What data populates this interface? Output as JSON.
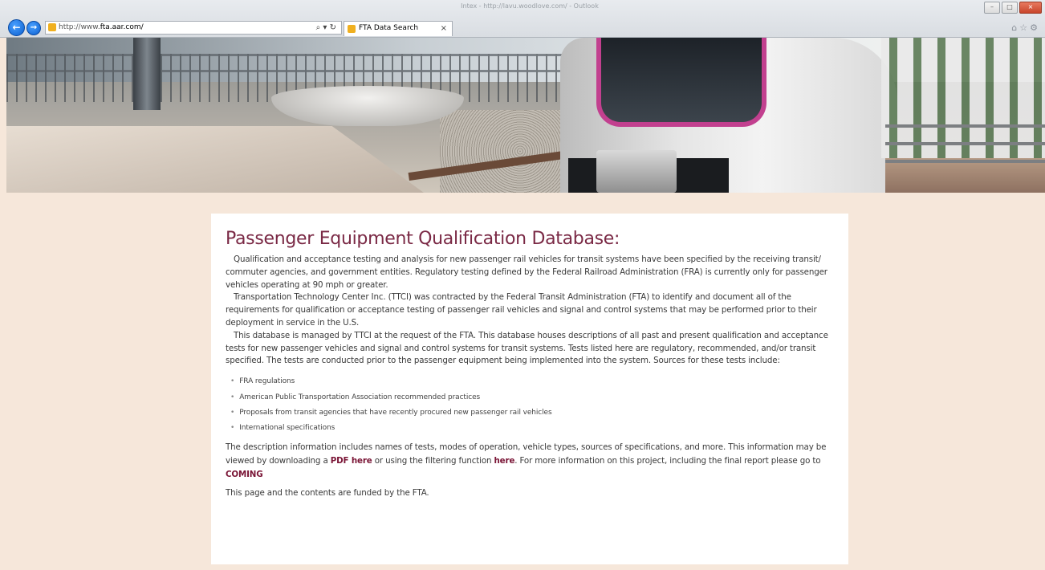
{
  "browser": {
    "window_title": "Intex - http://lavu.woodlove.com/ - Outlook",
    "address_url": "http://www.",
    "address_host": "fta.aar.com/",
    "tab_title": "FTA Data Search",
    "search_icon": "search-icon",
    "refresh_icon": "refresh-icon",
    "tab_close": "×",
    "back_icon": "←",
    "forward_icon": "→",
    "toolbar_icons": "⌂☆⚙"
  },
  "content": {
    "title": "Passenger Equipment Qualification Database:",
    "para1": "Qualification and acceptance testing and analysis for new passenger rail vehicles for transit systems have been specified by the receiving transit/ commuter agencies, and government entities.  Regulatory testing defined by the Federal Railroad Administration (FRA) is currently only for passenger vehicles operating at 90 mph or greater.",
    "para2": "Transportation Technology Center Inc. (TTCI) was contracted by the Federal Transit Administration (FTA) to identify and document all of the requirements for qualification or acceptance testing of passenger rail vehicles and signal and control systems that may be performed prior to their deployment in service in the U.S.",
    "para3": "This database is managed by TTCI at the request of the FTA. This database houses descriptions of all past and present qualification and acceptance tests for new passenger vehicles and signal and control systems for transit systems.  Tests listed here are regulatory, recommended, and/or transit specified.  The tests are conducted prior to the passenger equipment being implemented into the system. Sources for these tests include:",
    "sources": [
      "FRA regulations",
      "American Public Transportation Association recommended practices",
      "Proposals from transit agencies that have recently procured new passenger rail vehicles",
      "International specifications"
    ],
    "desc_part1": "The description information includes names of tests, modes of operation, vehicle types, sources of specifications, and more. This information may be viewed by downloading a ",
    "pdf_link": "PDF here",
    "desc_part2": " or using the filtering function ",
    "filter_link": "here",
    "desc_part3": ".  For more information on this project, including the final report please go to ",
    "coming_link": "COMING",
    "funding": "This page and the contents are funded by the FTA."
  },
  "colors": {
    "page_bg": "#f6e7da",
    "title": "#7a2945",
    "link": "#7a1536"
  }
}
